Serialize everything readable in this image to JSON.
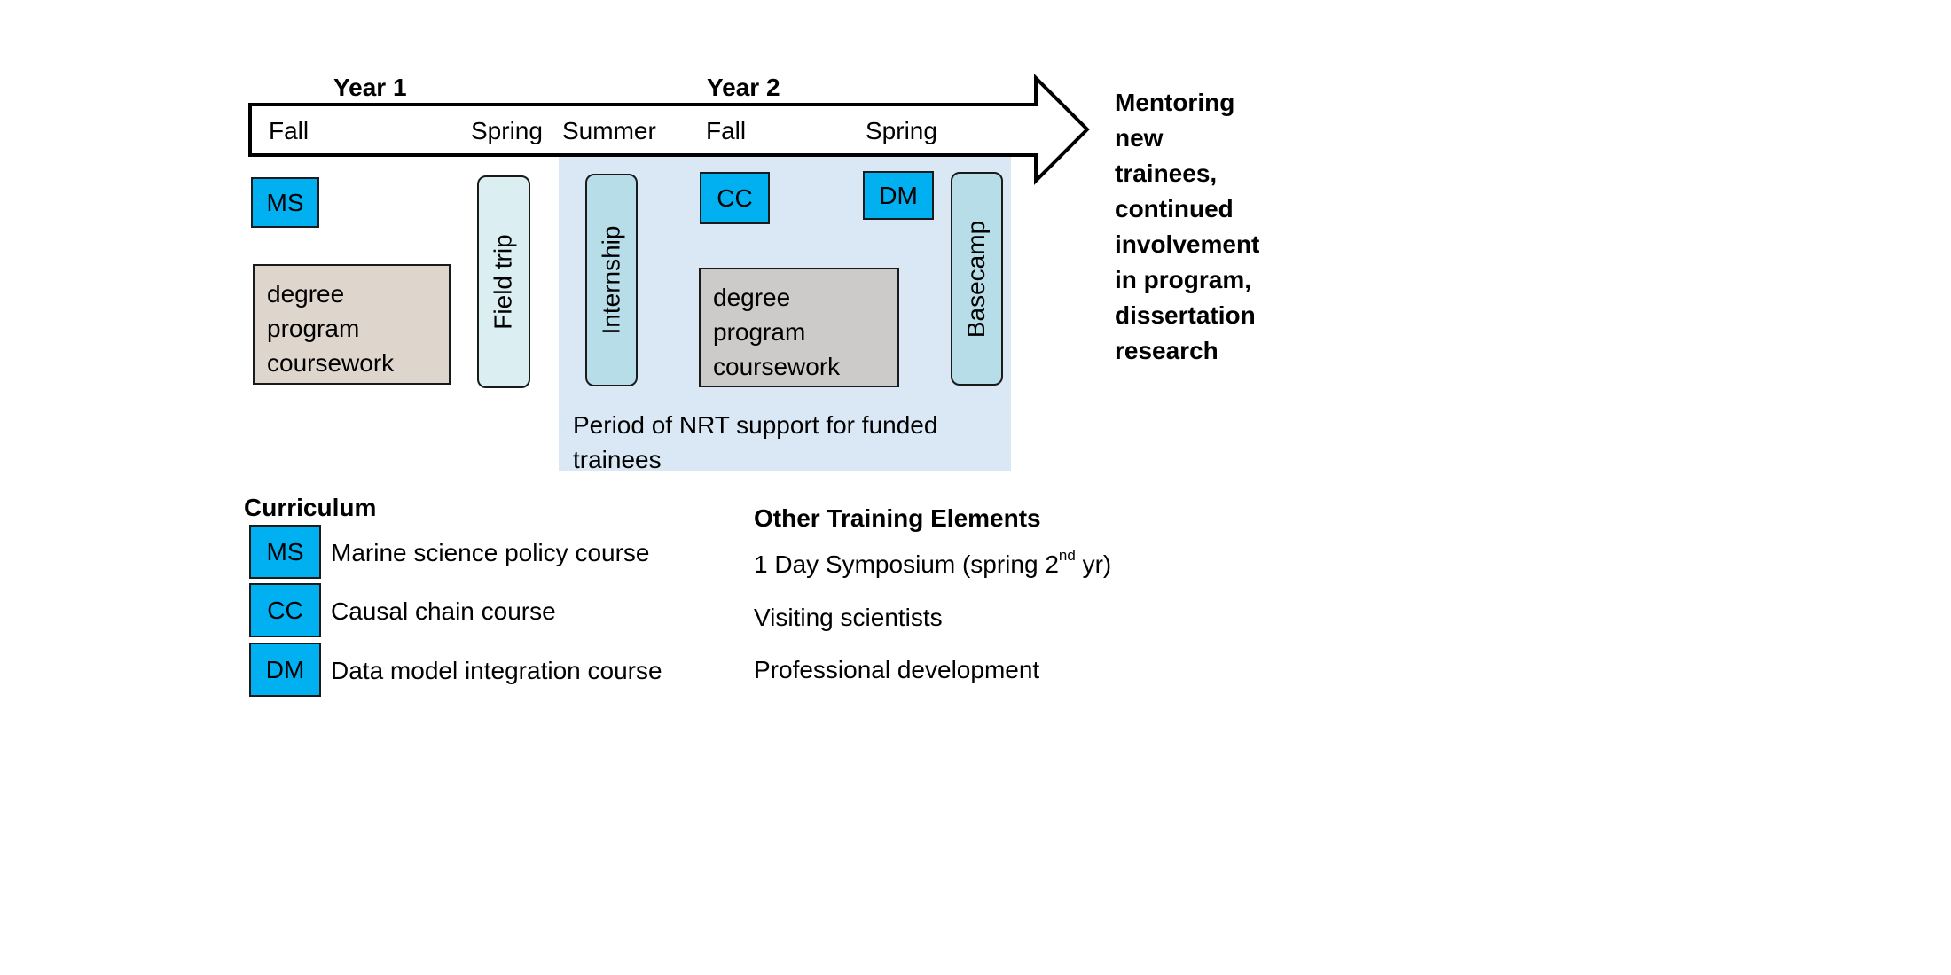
{
  "timeline": {
    "years": [
      {
        "label": "Year 1"
      },
      {
        "label": "Year 2"
      }
    ],
    "seasons": [
      {
        "label": "Fall"
      },
      {
        "label": "Spring"
      },
      {
        "label": "Summer"
      },
      {
        "label": "Fall"
      },
      {
        "label": "Spring"
      }
    ],
    "outcome_lines": [
      "Mentoring",
      "new",
      "trainees,",
      "continued",
      "involvement",
      "in program,",
      "dissertation",
      "research"
    ]
  },
  "nrt_period": {
    "label_line1": "Period of NRT support for funded",
    "label_line2": "trainees",
    "color": "#dae8f5"
  },
  "blocks": {
    "ms": "MS",
    "cc": "CC",
    "dm": "DM",
    "coursework_year1": [
      "degree",
      "program",
      "coursework"
    ],
    "coursework_year2": [
      "degree",
      "program",
      "coursework"
    ],
    "field_trip": "Field trip",
    "internship": "Internship",
    "basecamp": "Basecamp"
  },
  "colors": {
    "course": "#00b0f0",
    "coursework_year1": "#ded5cc",
    "coursework_year2": "#cccbca",
    "field_trip": "#dbeff3",
    "internship": "#b7dee8",
    "basecamp": "#b7dee8"
  },
  "curriculum": {
    "title": "Curriculum",
    "items": [
      {
        "code": "MS",
        "label": "Marine science policy course"
      },
      {
        "code": "CC",
        "label": "Causal chain course"
      },
      {
        "code": "DM",
        "label": "Data model integration course"
      }
    ]
  },
  "other_training": {
    "title": "Other Training Elements",
    "items": [
      {
        "label": "1 Day Symposium (spring 2",
        "sup": "nd",
        "suffix": " yr)"
      },
      {
        "label": "Visiting scientists"
      },
      {
        "label": "Professional development"
      }
    ]
  }
}
